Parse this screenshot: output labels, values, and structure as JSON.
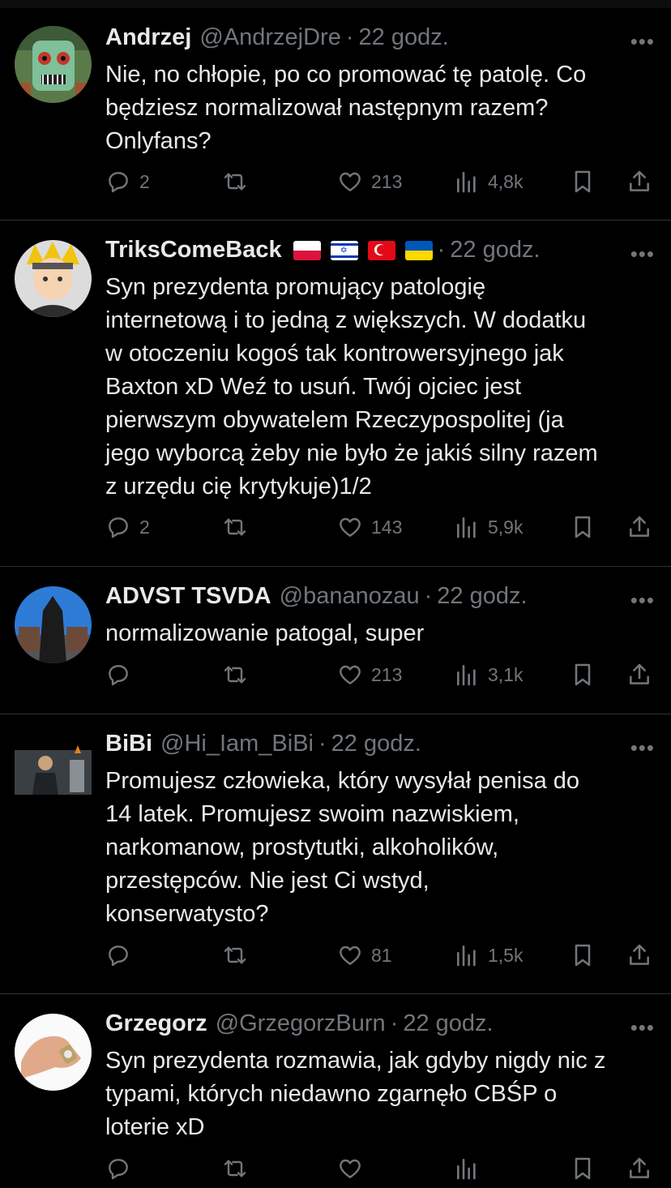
{
  "tweets": [
    {
      "name": "Andrzej",
      "handle": "@AndrzejDre",
      "time": "22 godz.",
      "text": "Nie, no chłopie, po co promować tę patolę. Co\nbędziesz normalizował następnym razem?\nOnlyfans?",
      "replies": "2",
      "retweets": "",
      "likes": "213",
      "views": "4,8k",
      "avatar_icon": "green-robot-mask-avatar"
    },
    {
      "name": "TriksComeBack",
      "handle": "",
      "time": "22 godz.",
      "flags": [
        "poland-flag",
        "israel-flag",
        "turkey-flag",
        "ukraine-flag"
      ],
      "text": "Syn prezydenta promujący patologię\ninternetową i to jedną z większych. W dodatku\nw otoczeniu kogoś tak kontrowersyjnego jak\nBaxton xD Weź to usuń. Twój ojciec jest\npierwszym obywatelem Rzeczypospolitej (ja\njego wyborcą żeby nie było że jakiś silny razem\nz urzędu cię krytykuje)1/2",
      "replies": "2",
      "retweets": "",
      "likes": "143",
      "views": "5,9k",
      "avatar_icon": "anime-character-avatar"
    },
    {
      "name": "ADVST TSVDA",
      "handle": "@bananozau",
      "time": "22 godz.",
      "text": "normalizowanie patogal, super",
      "replies": "",
      "retweets": "",
      "likes": "213",
      "views": "3,1k",
      "avatar_icon": "dark-figure-avatar"
    },
    {
      "name": "BiBi",
      "handle": "@Hi_Iam_BiBi",
      "time": "22 godz.",
      "text": "Promujesz człowieka, który wysyłał penisa do\n14 latek. Promujesz swoim nazwiskiem,\nnarkomanow, prostytutki, alkoholików,\nprzestępców. Nie jest Ci wstyd,\nkonserwatysto?",
      "replies": "",
      "retweets": "",
      "likes": "81",
      "views": "1,5k",
      "avatar_icon": "man-in-suit-avatar"
    },
    {
      "name": "Grzegorz",
      "handle": "@GrzegorzBurn",
      "time": "22 godz.",
      "text": "Syn prezydenta rozmawia, jak gdyby nigdy nic z\ntypami, których niedawno zgarnęło CBŚP o\nloterie  xD",
      "replies": "",
      "retweets": "",
      "likes": "",
      "views": "",
      "avatar_icon": "flexed-arm-watch-avatar"
    }
  ],
  "colors": {
    "background": "#000000",
    "text": "#e7e9ea",
    "muted": "#71767b",
    "divider": "#2f3336"
  }
}
